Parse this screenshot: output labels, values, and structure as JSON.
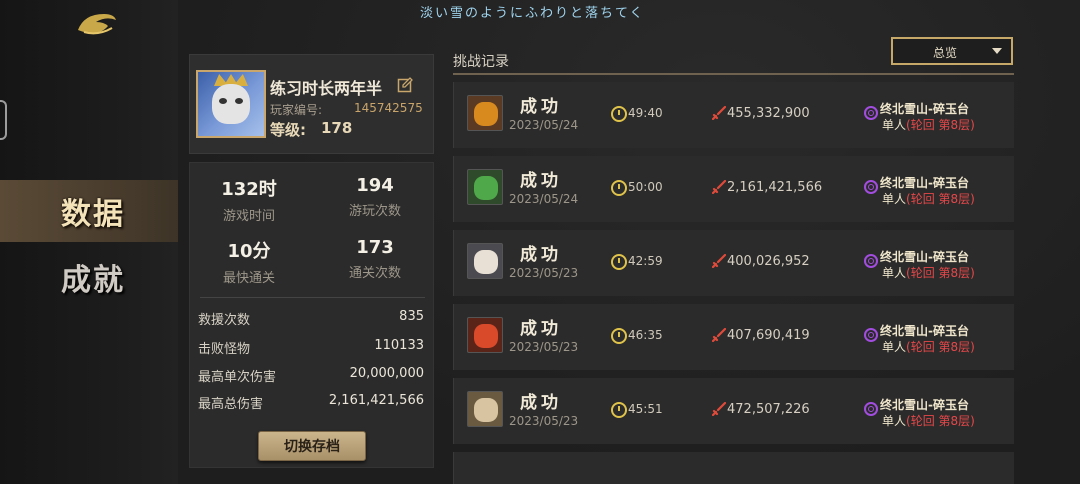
{
  "top_caption": "淡い雪のようにふわりと落ちてく",
  "sidebar": {
    "tabs": [
      {
        "label": "数据",
        "active": true
      },
      {
        "label": "成就",
        "active": false
      }
    ]
  },
  "profile": {
    "name": "练习时长两年半",
    "id_label": "玩家编号:",
    "id": "145742575",
    "level_label": "等级:",
    "level": "178"
  },
  "stats": {
    "grid": [
      {
        "value": "132时",
        "label": "游戏时间"
      },
      {
        "value": "194",
        "label": "游玩次数"
      },
      {
        "value": "10分",
        "label": "最快通关"
      },
      {
        "value": "173",
        "label": "通关次数"
      }
    ],
    "rows": [
      {
        "label": "救援次数",
        "value": "835"
      },
      {
        "label": "击败怪物",
        "value": "110133"
      },
      {
        "label": "最高单次伤害",
        "value": "20,000,000"
      },
      {
        "label": "最高总伤害",
        "value": "2,161,421,566"
      }
    ],
    "switch_button": "切换存档"
  },
  "records": {
    "title": "挑战记录",
    "filter": "总览",
    "items": [
      {
        "result": "成功",
        "date": "2023/05/24",
        "time": "49:40",
        "damage": "455,332,900",
        "location": "终北雪山-碎玉台",
        "mode": "单人",
        "mode_detail": "(轮回 第8层)",
        "hero_color": "#d98a1f"
      },
      {
        "result": "成功",
        "date": "2023/05/24",
        "time": "50:00",
        "damage": "2,161,421,566",
        "location": "终北雪山-碎玉台",
        "mode": "单人",
        "mode_detail": "(轮回 第8层)",
        "hero_color": "#4fa84a"
      },
      {
        "result": "成功",
        "date": "2023/05/23",
        "time": "42:59",
        "damage": "400,026,952",
        "location": "终北雪山-碎玉台",
        "mode": "单人",
        "mode_detail": "(轮回 第8层)",
        "hero_color": "#e8e0d4"
      },
      {
        "result": "成功",
        "date": "2023/05/23",
        "time": "46:35",
        "damage": "407,690,419",
        "location": "终北雪山-碎玉台",
        "mode": "单人",
        "mode_detail": "(轮回 第8层)",
        "hero_color": "#d84a2a"
      },
      {
        "result": "成功",
        "date": "2023/05/23",
        "time": "45:51",
        "damage": "472,507,226",
        "location": "终北雪山-碎玉台",
        "mode": "单人",
        "mode_detail": "(轮回 第8层)",
        "hero_color": "#d8c4a0"
      }
    ]
  },
  "colors": {
    "accent": "#c6a868",
    "mode_red": "#e5484a",
    "clock": "#e0c34a",
    "spiral": "#a34de0"
  }
}
